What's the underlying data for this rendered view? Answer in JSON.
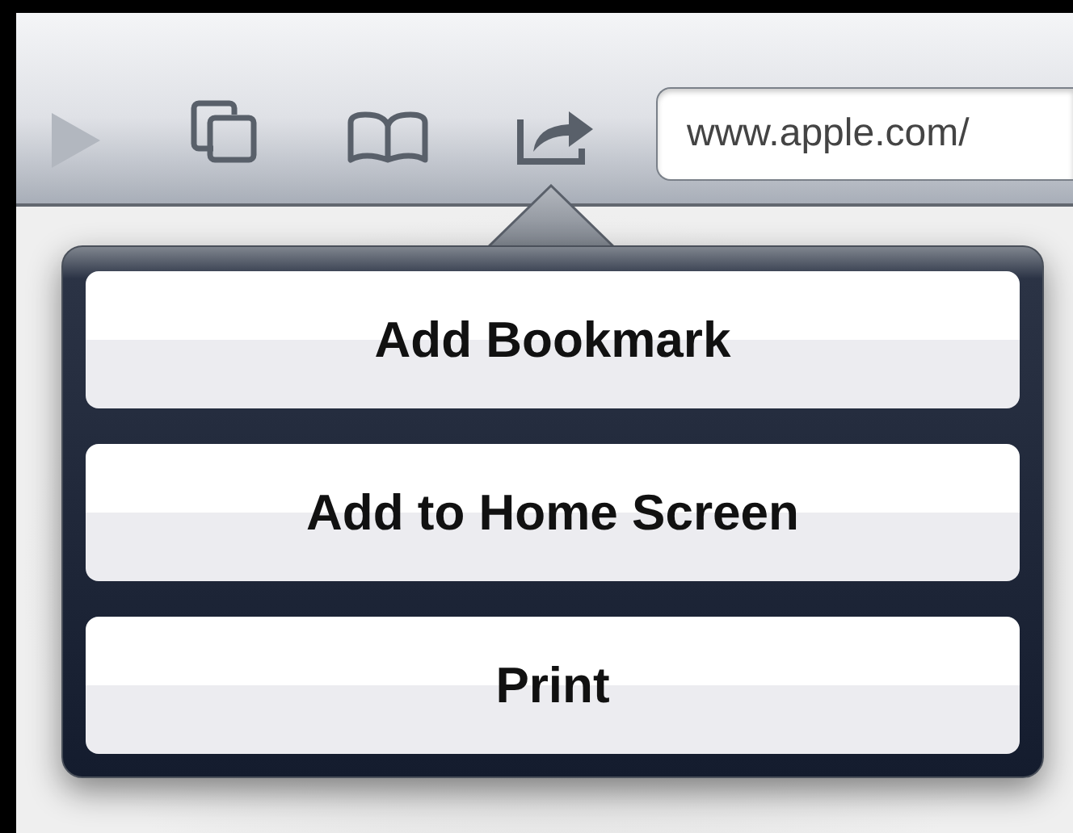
{
  "toolbar": {
    "forward_disabled": true,
    "url": "www.apple.com/"
  },
  "share_menu": {
    "items": [
      {
        "label": "Add Bookmark"
      },
      {
        "label": "Add to Home Screen"
      },
      {
        "label": "Print"
      }
    ]
  }
}
